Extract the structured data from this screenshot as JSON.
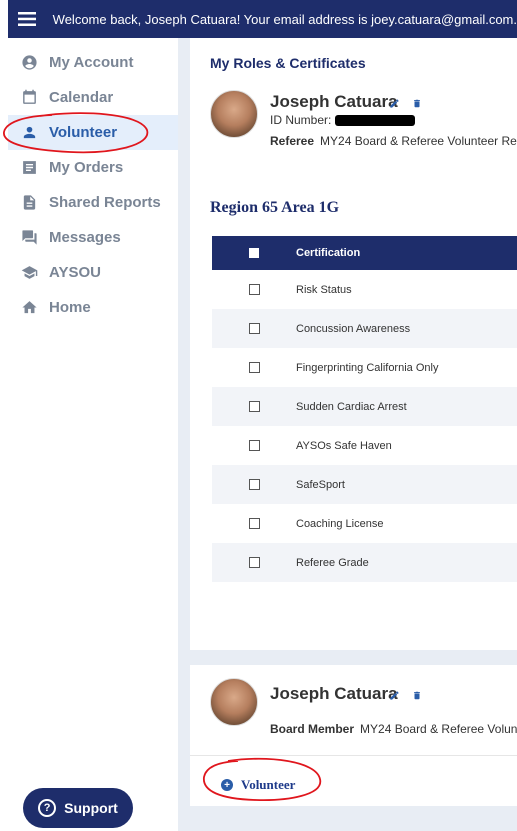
{
  "header": {
    "welcome_text": "Welcome back, Joseph Catuara! Your email address is joey.catuara@gmail.com."
  },
  "sidebar": {
    "items": [
      {
        "label": "My Account",
        "icon": "account-circle-icon"
      },
      {
        "label": "Calendar",
        "icon": "calendar-icon"
      },
      {
        "label": "Volunteer",
        "icon": "person-icon",
        "active": true
      },
      {
        "label": "My Orders",
        "icon": "orders-list-icon"
      },
      {
        "label": "Shared Reports",
        "icon": "document-icon"
      },
      {
        "label": "Messages",
        "icon": "chat-icon"
      },
      {
        "label": "AYSOU",
        "icon": "graduation-cap-icon"
      },
      {
        "label": "Home",
        "icon": "home-icon"
      }
    ],
    "support_label": "Support"
  },
  "roles_card": {
    "title": "My Roles & Certificates",
    "name": "Joseph Catuara",
    "id_label": "ID Number:",
    "role_type": "Referee",
    "role_desc": "MY24 Board & Referee Volunteer Re",
    "region_title": "Region 65 Area 1G",
    "table_header": "Certification",
    "certifications": [
      "Risk Status",
      "Concussion Awareness",
      "Fingerprinting California Only",
      "Sudden Cardiac Arrest",
      "AYSOs Safe Haven",
      "SafeSport",
      "Coaching License",
      "Referee Grade"
    ]
  },
  "board_card": {
    "name": "Joseph Catuara",
    "role_type": "Board Member",
    "role_desc": "MY24 Board & Referee Volunt",
    "add_label": "Volunteer"
  },
  "colors": {
    "brand_navy": "#1e2d6b",
    "accent_blue": "#2a5da8",
    "annotation_red": "#e0161d"
  }
}
